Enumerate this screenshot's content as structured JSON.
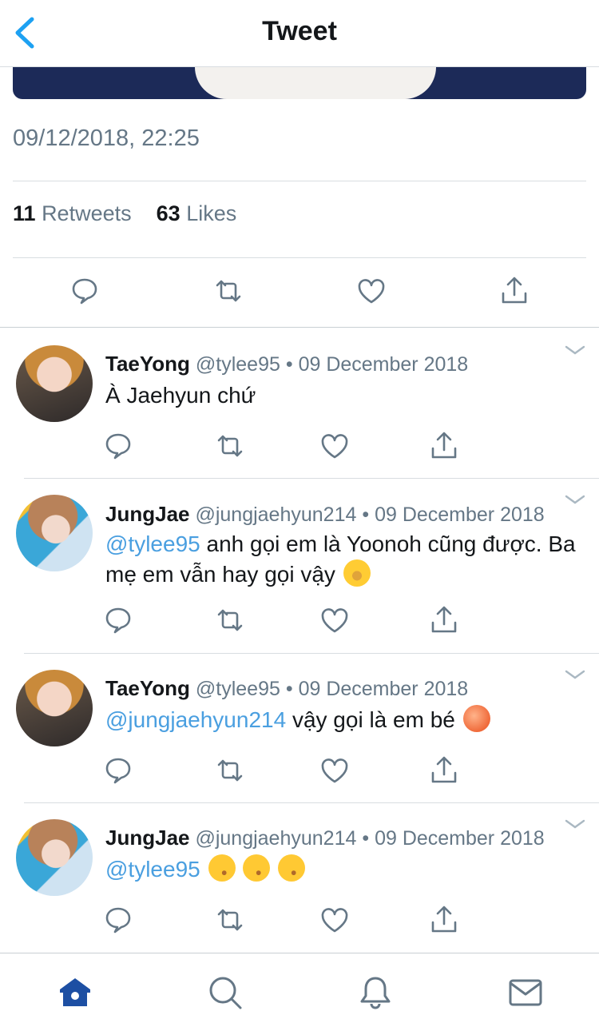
{
  "header": {
    "title": "Tweet",
    "back_icon": "chevron-left-icon",
    "accent": "#1da1f2"
  },
  "tweet": {
    "timestamp": "09/12/2018, 22:25",
    "retweets_count": "11",
    "retweets_label": "Retweets",
    "likes_count": "63",
    "likes_label": "Likes",
    "actions": [
      "reply-icon",
      "retweet-icon",
      "like-icon",
      "share-icon"
    ]
  },
  "replies": [
    {
      "name": "TaeYong",
      "handle": "@tylee95",
      "sep": "•",
      "date": "09 December 2018",
      "mention": "",
      "text": "À Jaehyun chứ"
    },
    {
      "name": "JungJae",
      "handle": "@jungjaehyun214",
      "sep": "•",
      "date": "09 December 2018",
      "mention": "@tylee95",
      "text": "anh gọi em là Yoonoh cũng được. Ba mẹ em vẫn hay gọi vậy",
      "emoji": "face-with-tears-of-joy-emoji"
    },
    {
      "name": "TaeYong",
      "handle": "@tylee95",
      "sep": "•",
      "date": "09 December 2018",
      "mention": "@jungjaehyun214",
      "text": "vậy gọi là em bé",
      "emoji": "peach-emoji"
    },
    {
      "name": "JungJae",
      "handle": "@jungjaehyun214",
      "sep": "•",
      "date": "09 December 2018",
      "mention": "@tylee95",
      "text": "",
      "emoji": "kissing-face-emoji x3"
    }
  ],
  "tabbar": {
    "items": [
      "home-icon",
      "search-icon",
      "notifications-icon",
      "messages-icon"
    ],
    "active_color": "#1d4fa3",
    "inactive_color": "#657786"
  }
}
